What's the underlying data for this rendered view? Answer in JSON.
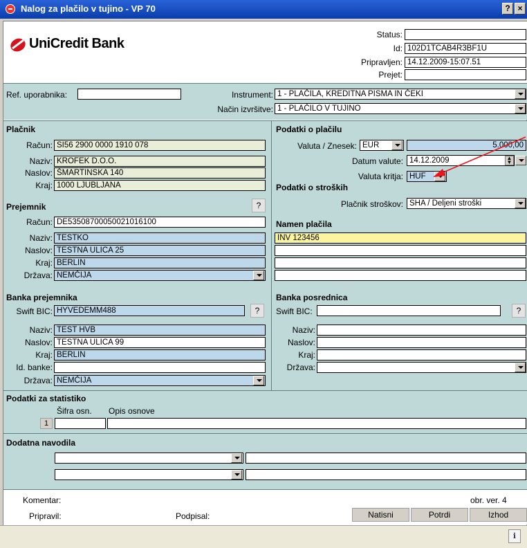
{
  "window": {
    "title": "Nalog za plačilo v tujino - VP 70",
    "help_btn": "?",
    "close_btn": "×"
  },
  "logo": {
    "brand": "UniCredit Bank",
    "colors": {
      "brand_red": "#d3141c"
    }
  },
  "status_block": {
    "status_label": "Status:",
    "status_value": "",
    "id_label": "Id:",
    "id_value": "102D1TCAB4R3BF1U",
    "prepared_label": "Pripravljen:",
    "prepared_value": "14.12.2009-15:07.51",
    "received_label": "Prejet:",
    "received_value": ""
  },
  "ref_row": {
    "ref_label": "Ref. uporabnika:",
    "ref_value": "",
    "instrument_label": "Instrument:",
    "instrument_value": "1 - PLAČILA, KREDITNA PISMA IN ČEKI",
    "method_label": "Način izvršitve:",
    "method_value": "1 - PLAČILO V TUJINO"
  },
  "payer": {
    "heading": "Plačnik",
    "account_label": "Račun:",
    "account_value": "SI56 2900 0000 1910 078",
    "name_label": "Naziv:",
    "name_value": "KROFEK D.O.O.",
    "address_label": "Naslov:",
    "address_value": "ŠMARTINSKA 140",
    "city_label": "Kraj:",
    "city_value": "1000 LJUBLJANA"
  },
  "payment": {
    "heading": "Podatki o plačilu",
    "amount_label": "Valuta / Znesek:",
    "currency_value": "EUR",
    "amount_value": "5.000,00",
    "date_label": "Datum valute:",
    "date_value": "14.12.2009",
    "cover_label": "Valuta kritja:",
    "cover_value": "HUF"
  },
  "costs": {
    "heading": "Podatki o stroških",
    "payer_label": "Plačnik stroškov:",
    "payer_value": "SHA / Deljeni stroški"
  },
  "recipient": {
    "heading": "Prejemnik",
    "help": "?",
    "account_label": "Račun:",
    "account_value": "DE53508700050021016100",
    "name_label": "Naziv:",
    "name_value": "TESTKO",
    "address_label": "Naslov:",
    "address_value": "TESTNA ULICA 25",
    "city_label": "Kraj:",
    "city_value": "BERLIN",
    "country_label": "Država:",
    "country_value": "NEMČIJA"
  },
  "purpose": {
    "heading": "Namen plačila",
    "lines": [
      "INV 123456",
      "",
      "",
      ""
    ]
  },
  "recipient_bank": {
    "heading": "Banka prejemnika",
    "help": "?",
    "swift_label": "Swift BIC:",
    "swift_value": "HYVEDEMM488",
    "name_label": "Naziv:",
    "name_value": "TEST HVB",
    "address_label": "Naslov:",
    "address_value": "TESTNA ULICA 99",
    "city_label": "Kraj:",
    "city_value": "BERLIN",
    "bankid_label": "Id. banke:",
    "bankid_value": "",
    "country_label": "Država:",
    "country_value": "NEMČIJA"
  },
  "intermediary_bank": {
    "heading": "Banka posrednica",
    "help": "?",
    "swift_label": "Swift BIC:",
    "swift_value": "",
    "name_label": "Naziv:",
    "name_value": "",
    "address_label": "Naslov:",
    "address_value": "",
    "city_label": "Kraj:",
    "city_value": "",
    "country_label": "Država:",
    "country_value": ""
  },
  "statistics": {
    "heading": "Podatki za statistiko",
    "code_header": "Šifra osn.",
    "desc_header": "Opis osnove",
    "row_number": "1",
    "code_value": "",
    "desc_value": ""
  },
  "extra": {
    "heading": "Dodatna navodila"
  },
  "footer": {
    "comment_label": "Komentar:",
    "version": "obr. ver. 4",
    "prepared_by_label": "Pripravil:",
    "signed_label": "Podpisal:",
    "print_btn": "Natisni",
    "confirm_btn": "Potrdi",
    "exit_btn": "Izhod"
  }
}
